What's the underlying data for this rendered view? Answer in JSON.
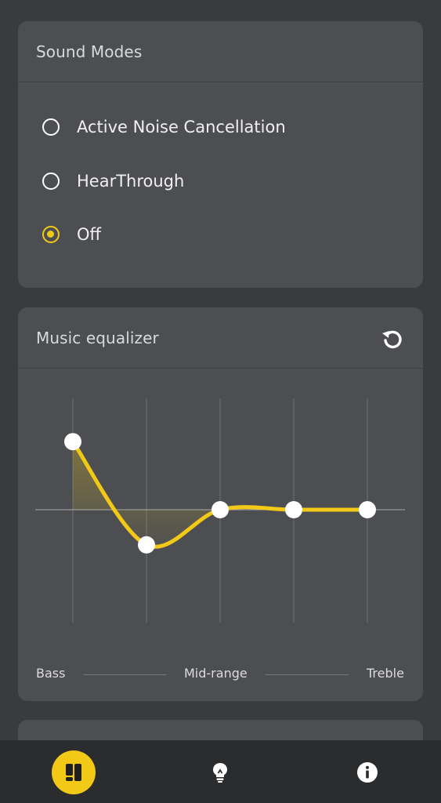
{
  "sound_modes": {
    "title": "Sound Modes",
    "options": [
      {
        "label": "Active Noise Cancellation",
        "selected": false
      },
      {
        "label": "HearThrough",
        "selected": false
      },
      {
        "label": "Off",
        "selected": true
      }
    ]
  },
  "equalizer": {
    "title": "Music equalizer",
    "reset_icon": "reset-icon",
    "bands": [
      {
        "level": 0.62
      },
      {
        "level": -0.32
      },
      {
        "level": 0.0
      },
      {
        "level": 0.0
      },
      {
        "level": 0.0
      }
    ],
    "range_labels": {
      "low": "Bass",
      "mid": "Mid-range",
      "high": "Treble"
    }
  },
  "bottom_nav": {
    "items": [
      {
        "icon": "dashboard-icon",
        "active": true
      },
      {
        "icon": "lightbulb-icon",
        "active": false
      },
      {
        "icon": "info-icon",
        "active": false
      }
    ]
  },
  "colors": {
    "accent": "#f2c916",
    "background": "#3a3b3e",
    "card": "#4d4e52",
    "nav": "#2b2c2e"
  }
}
